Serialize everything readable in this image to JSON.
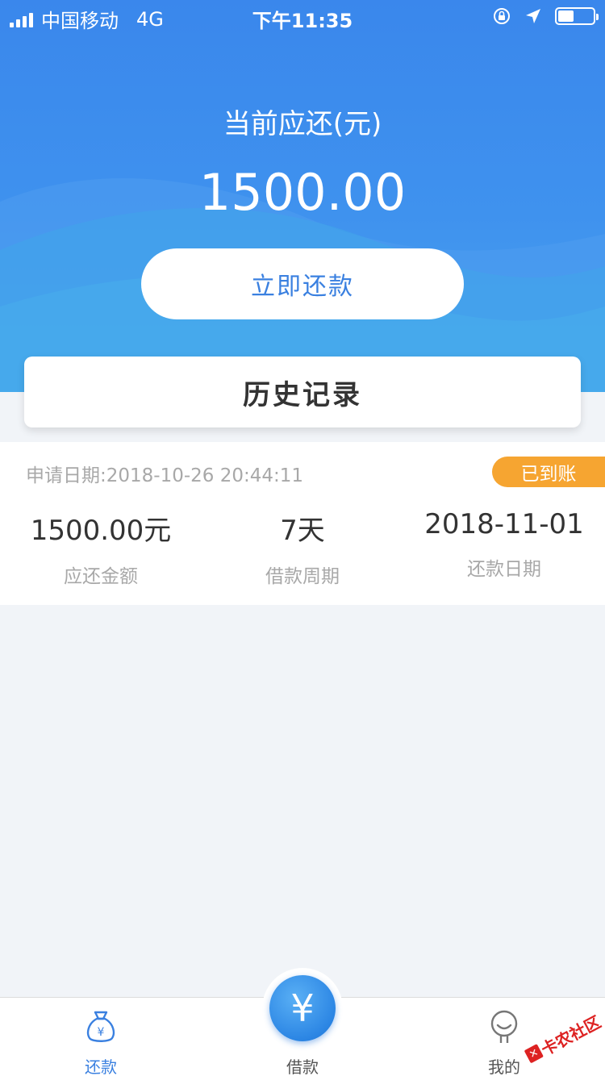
{
  "status_bar": {
    "carrier": "中国移动",
    "network": "4G",
    "time": "下午11:35",
    "battery_level": 0.45
  },
  "hero": {
    "label": "当前应还(元)",
    "amount": "1500.00",
    "repay_button": "立即还款"
  },
  "history": {
    "title": "历史记录"
  },
  "record": {
    "apply_date": "申请日期:2018-10-26 20:44:11",
    "status_badge": "已到账",
    "amount_value": "1500.00元",
    "amount_label": "应还金额",
    "period_value": "7天",
    "period_label": "借款周期",
    "due_value": "2018-11-01",
    "due_label": "还款日期"
  },
  "tabbar": {
    "tabs": [
      {
        "label": "还款",
        "icon": "money-bag-icon",
        "active": true
      },
      {
        "label": "借款",
        "icon": "yen-icon",
        "active": false
      },
      {
        "label": "我的",
        "icon": "profile-icon",
        "active": false
      }
    ],
    "center_symbol": "¥"
  },
  "watermark": {
    "text": "卡农社区"
  },
  "colors": {
    "primary": "#3a80e0",
    "badge": "#f6a531"
  }
}
